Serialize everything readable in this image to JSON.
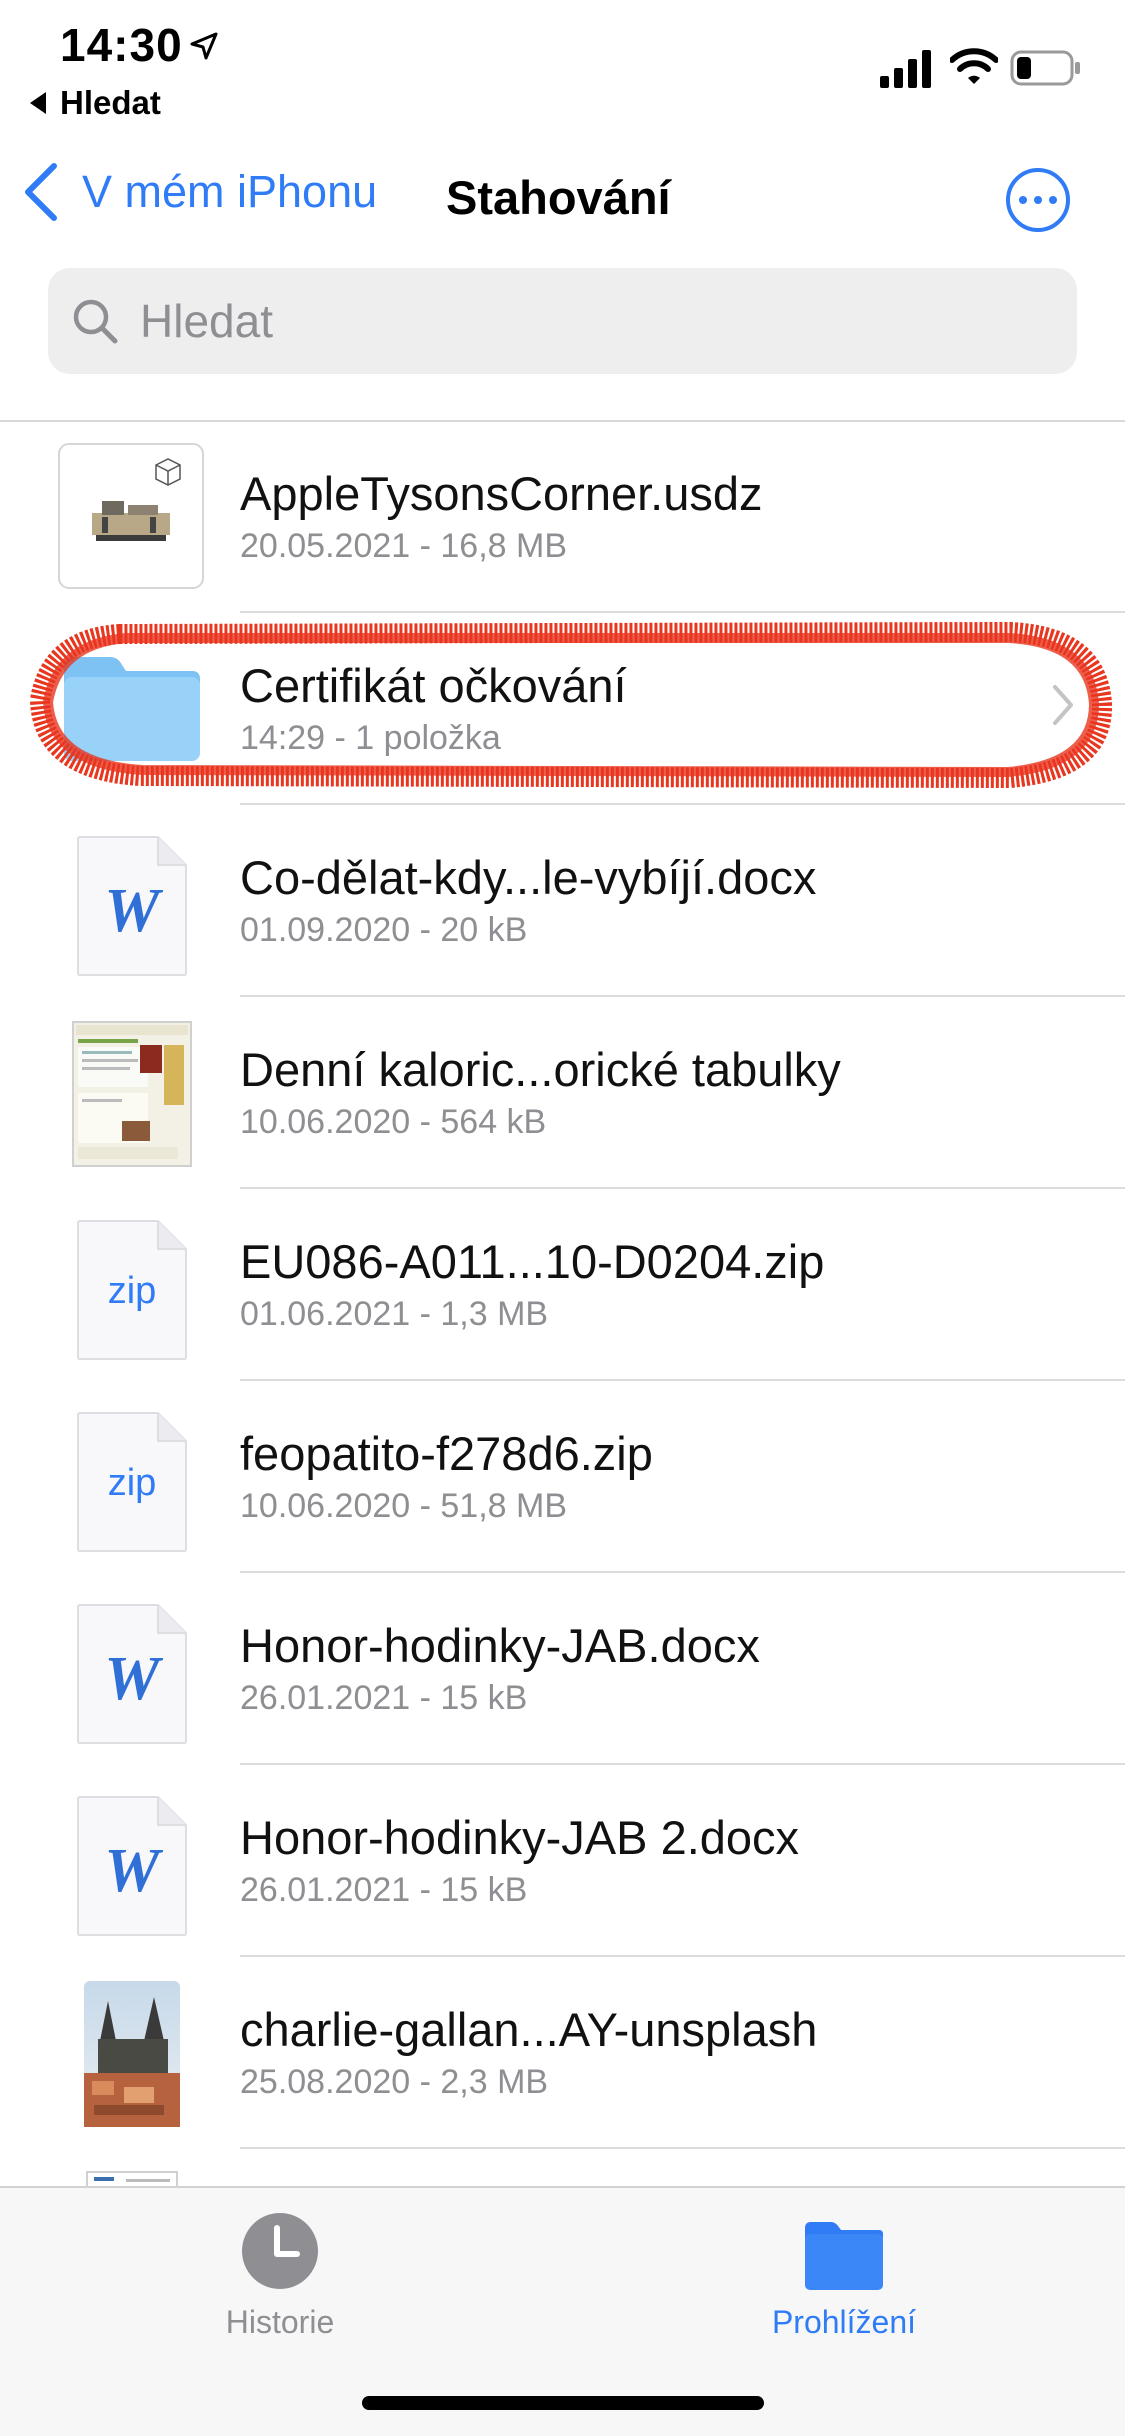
{
  "status_bar": {
    "time": "14:30",
    "back_app": "Hledat"
  },
  "nav": {
    "back_label": "V mém iPhonu",
    "title": "Stahování"
  },
  "search": {
    "placeholder": "Hledat"
  },
  "files": [
    {
      "name": "AppleTysonsCorner.usdz",
      "meta": "20.05.2021 - 16,8 MB",
      "icon": "usdz-thumbnail"
    },
    {
      "name": "Certifikát očkování",
      "meta": "14:29 - 1 položka",
      "icon": "folder-icon"
    },
    {
      "name": "Co-dělat-kdy...le-vybíjí.docx",
      "meta": "01.09.2020 - 20 kB",
      "icon": "word-doc-icon"
    },
    {
      "name": "Denní kaloric...orické tabulky",
      "meta": "10.06.2020 - 564 kB",
      "icon": "webpage-thumbnail"
    },
    {
      "name": "EU086-A011...10-D0204.zip",
      "meta": "01.06.2021 - 1,3 MB",
      "icon": "zip-icon"
    },
    {
      "name": "feopatito-f278d6.zip",
      "meta": "10.06.2020 - 51,8 MB",
      "icon": "zip-icon"
    },
    {
      "name": "Honor-hodinky-JAB.docx",
      "meta": "26.01.2021 - 15 kB",
      "icon": "word-doc-icon"
    },
    {
      "name": "Honor-hodinky-JAB 2.docx",
      "meta": "26.01.2021 - 15 kB",
      "icon": "word-doc-icon"
    },
    {
      "name": "charlie-gallan...AY-unsplash",
      "meta": "25.08.2020 - 2,3 MB",
      "icon": "photo-thumbnail"
    }
  ],
  "doc_letter": "W",
  "zip_label": "zip",
  "tabs": [
    {
      "label": "Historie",
      "icon": "clock-icon",
      "active": false
    },
    {
      "label": "Prohlížení",
      "icon": "folder-icon",
      "active": true
    }
  ],
  "colors": {
    "accent": "#2f7cf6",
    "highlight": "#e8361f",
    "folder": "#8ccbf7",
    "secondary_text": "#8e8e93"
  }
}
